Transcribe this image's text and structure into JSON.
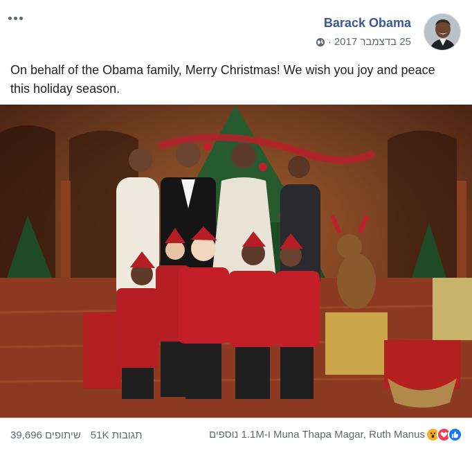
{
  "post": {
    "author": "Barack Obama",
    "date": "25 בדצמבר 2017",
    "privacy_icon": "globe-icon",
    "more_icon": "more-icon",
    "text": "On behalf of the Obama family, Merry Christmas! We wish you joy and peace this holiday season."
  },
  "footer": {
    "shares": "39,696 שיתופים",
    "comments": "51K תגובות",
    "reactors": "Muna Thapa Magar, Ruth Manus ו-1.1M נוספים",
    "reaction_icons": [
      "like-icon",
      "love-icon",
      "wow-icon"
    ]
  },
  "colors": {
    "author": "#385898",
    "secondary_text": "#606770",
    "like": "#1877f2",
    "love": "#f33e58",
    "wow": "#f7b125"
  }
}
